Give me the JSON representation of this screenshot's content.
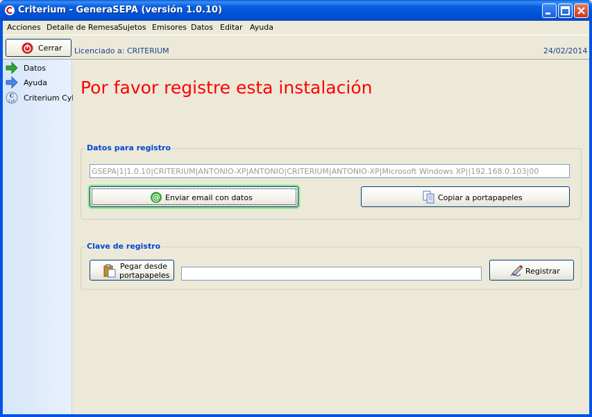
{
  "window": {
    "title": "Criterium - GeneraSEPA (versión 1.0.10)",
    "controls": {
      "minimize": "minimize",
      "maximize": "maximize",
      "close": "close"
    }
  },
  "menu": [
    "Acciones",
    "Detalle de Remesa",
    "Sujetos",
    "Emisores",
    "Datos",
    "Editar",
    "Ayuda"
  ],
  "toolbar": {
    "close_label": "Cerrar",
    "license_text": "Licenciado a: CRITERIUM",
    "date": "24/02/2014"
  },
  "sidebar": {
    "items": [
      {
        "label": "Datos",
        "icon": "green-arrow-icon"
      },
      {
        "label": "Ayuda",
        "icon": "blue-arrow-icon"
      },
      {
        "label": "Criterium CyP",
        "icon": "criterium-cyp-icon"
      }
    ]
  },
  "main": {
    "headline": "Por favor registre esta instalación",
    "registration_data": {
      "group_title": "Datos para registro",
      "value": "GSEPA|1|1.0.10|CRITERIUM|ANTONIO-XP|ANTONIO|CRITERIUM|ANTONIO-XP|Microsoft Windows XP||192.168.0.103|00",
      "email_button": "Enviar email con datos",
      "copy_button": "Copiar a portapapeles"
    },
    "registration_key": {
      "group_title": "Clave de registro",
      "paste_button_line1": "Pegar desde",
      "paste_button_line2": "portapapeles",
      "key_value": "",
      "register_button": "Registrar"
    }
  },
  "colors": {
    "headline": "#ff0000",
    "group_title": "#0046d5",
    "titlebar": "#0054e3",
    "face": "#ece9d8"
  }
}
